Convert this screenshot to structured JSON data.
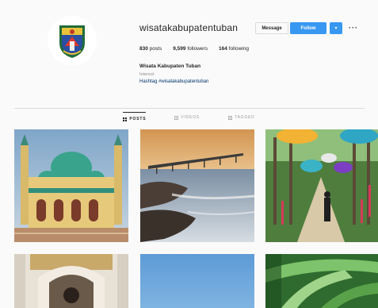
{
  "profile": {
    "username": "wisatakabupatentuban",
    "message_label": "Message",
    "follow_label": "Follow",
    "caret_label": "▾",
    "more_label": "···",
    "stats": {
      "posts_count": "830",
      "posts_label": "posts",
      "followers_count": "9,599",
      "followers_label": "followers",
      "following_count": "164",
      "following_label": "following"
    },
    "full_name": "Wisata Kabupaten Tuban",
    "category": "Interest",
    "bio": "Hashtag #wisatakabupatentuban"
  },
  "tabs": [
    {
      "label": "POSTS",
      "icon": "grid-icon",
      "active": true
    },
    {
      "label": "VIDEOS",
      "icon": "video-icon",
      "active": false
    },
    {
      "label": "TAGGED",
      "icon": "tag-icon",
      "active": false
    }
  ],
  "colors": {
    "follow_button": "#3897f0",
    "background": "#fafafa",
    "divider": "#dbdbdb"
  }
}
